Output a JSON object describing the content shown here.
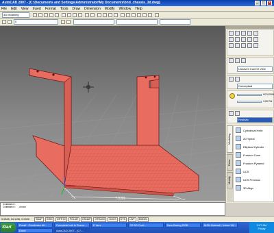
{
  "window": {
    "title": "AutoCAD 2007 - [C:\\Documents and Settings\\Administrator\\My Documents\\bnd_chassis_3d.dwg]"
  },
  "menu": [
    "File",
    "Edit",
    "View",
    "Insert",
    "Format",
    "Tools",
    "Draw",
    "Dimension",
    "Modify",
    "Window",
    "Help"
  ],
  "toolbar": {
    "workspace": "3D Modeling",
    "layer": "0"
  },
  "palette": {
    "view_label": "Unsaved Current View",
    "visual_style": "Conceptual",
    "time_a": "9/21/2006",
    "time_b": "3:00 PM",
    "material": "Realistic",
    "tab_modeling": "Modeling",
    "tab_draw": "Draw",
    "tab_modify": "Modify",
    "tools": [
      "Cylindrical Helix",
      "2D Spiral",
      "Elliptical Cylinder",
      "Frustum Cone",
      "Frustum Pyramid",
      "UCS",
      "UCS Previous",
      "3D Align"
    ]
  },
  "viewport": {
    "dimension_text": "7.9395"
  },
  "command": {
    "line1": "Command:",
    "line2": "Command: _zoom"
  },
  "status": {
    "coords": "0.0528, 34.1196, 0.0000",
    "buttons": [
      "SNAP",
      "GRID",
      "ORTHO",
      "POLAR",
      "OSNAP",
      "OTRACK",
      "DUCS",
      "DYN",
      "LWT",
      "MODEL"
    ]
  },
  "taskbar": {
    "start": "Start",
    "tasks": [
      "Email - Goodness dil...",
      "Complete bolt in Scene...",
      "E here",
      "22 5D Cont...",
      "New Boring RGB",
      "MSN Hotmail - Inbox: Mi..."
    ],
    "tasks2": [
      "Done",
      "AutoCAD 2007 - [C:\\..."
    ],
    "time": "3:07 AM",
    "day": "Friday"
  },
  "colors": {
    "solid": "#e86c5f",
    "solid_edge": "#6a1a1a",
    "viewport_top": "#595959"
  }
}
